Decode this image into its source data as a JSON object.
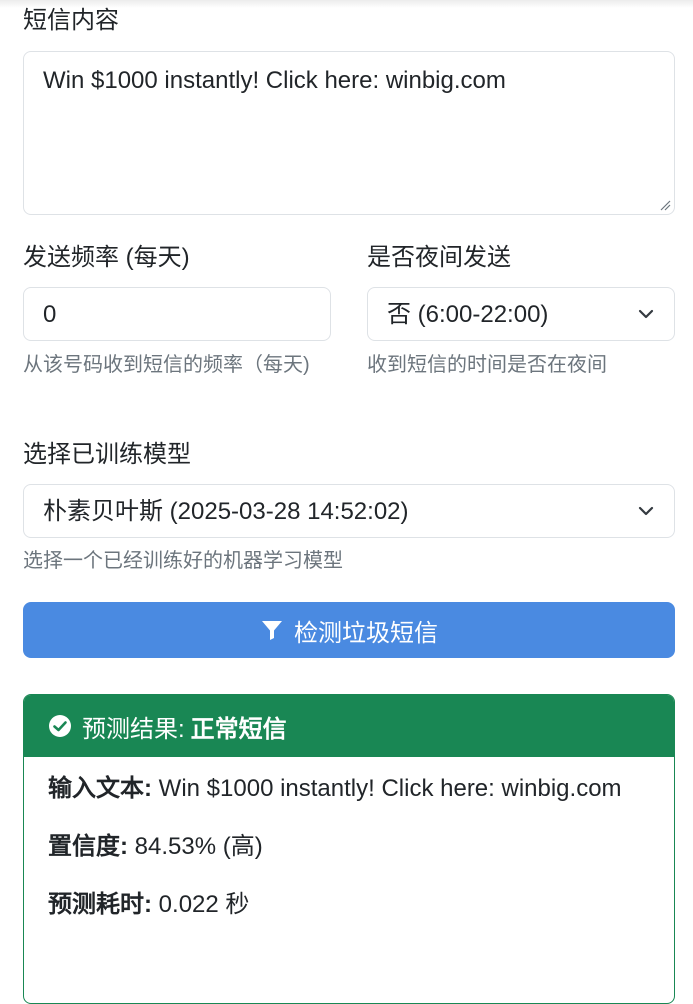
{
  "form": {
    "message": {
      "label": "短信内容",
      "value": "Win $1000 instantly! Click here: winbig.com"
    },
    "frequency": {
      "label": "发送频率 (每天)",
      "value": "0",
      "help": "从该号码收到短信的频率（每天)"
    },
    "night": {
      "label": "是否夜间发送",
      "selected": "否 (6:00-22:00)",
      "help": "收到短信的时间是否在夜间"
    },
    "model": {
      "label": "选择已训练模型",
      "selected": "朴素贝叶斯 (2025-03-28 14:52:02)",
      "help": "选择一个已经训练好的机器学习模型"
    },
    "submit_label": "检测垃圾短信"
  },
  "result": {
    "header_prefix": "预测结果:",
    "header_value": "正常短信",
    "input_text_label": "输入文本:",
    "input_text_value": "Win $1000 instantly! Click here: winbig.com",
    "confidence_label": "置信度:",
    "confidence_value": "84.53% (高)",
    "time_label": "预测耗时:",
    "time_value": "0.022 秒"
  },
  "colors": {
    "primary_button": "#4a8ae1",
    "success": "#198754",
    "border": "#dee2e6",
    "muted_text": "#6c757d"
  },
  "icons": {
    "submit": "filter-icon",
    "result": "check-circle-icon",
    "select": "chevron-down-icon"
  }
}
